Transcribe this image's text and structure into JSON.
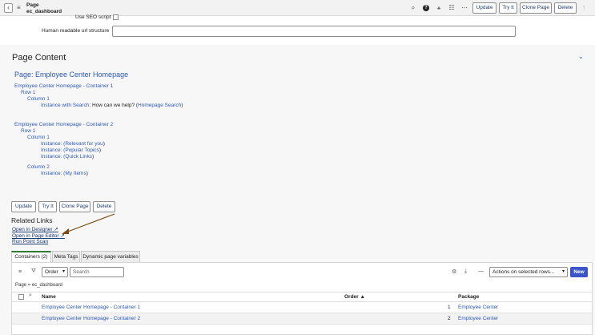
{
  "header": {
    "record_type": "Page",
    "record_name": "ec_dashboard",
    "buttons": [
      "Update",
      "Try It",
      "Clone Page",
      "Delete"
    ],
    "icons": [
      "attachment-icon",
      "help-icon",
      "activity-icon",
      "settings-sliders-icon",
      "more-icon"
    ]
  },
  "form": {
    "seo_label": "Use SEO script",
    "url_label": "Human readable url structure",
    "url_value": ""
  },
  "page_content": {
    "title": "Page Content",
    "page_link_label": "Page: Employee Center Homepage",
    "container1": {
      "name": "Employee Center Homepage - Container 1",
      "row": "Row 1",
      "column": "Column 1",
      "instance_link": "Instance with Search",
      "instance_text": ": How can we help?  (",
      "instance_paren_link": "Homepage Search",
      "instance_close": ")"
    },
    "container2": {
      "name": "Employee Center Homepage - Container 2",
      "row": "Row 1",
      "column1": "Column 1",
      "instances_col1": [
        {
          "prefix": "Instance:  (",
          "link": "Relevant for you",
          "suffix": ")"
        },
        {
          "prefix": "Instance:  (",
          "link": "Popular Topics",
          "suffix": ")"
        },
        {
          "prefix": "Instance:  (",
          "link": "Quick Links",
          "suffix": ")"
        }
      ],
      "column2": "Column 2",
      "instances_col2": [
        {
          "prefix": "Instance:  (",
          "link": "My Items",
          "suffix": ")"
        }
      ]
    }
  },
  "bottom_buttons": [
    "Update",
    "Try It",
    "Clone Page",
    "Delete"
  ],
  "related_links": {
    "title": "Related Links",
    "items": [
      "Open in Designer",
      "Open in Page Editor",
      "Run Point Scan"
    ]
  },
  "tabs": [
    "Containers (2)",
    "Meta Tags",
    "Dynamic page variables"
  ],
  "related_list": {
    "search_field": "Order",
    "search_placeholder": "Search",
    "actions_label": "Actions on selected rows...",
    "new_label": "New",
    "filter_text": "Page = ec_dashboard",
    "columns": [
      "Name",
      "Order",
      "Package"
    ],
    "sort_indicator": "▲",
    "rows": [
      {
        "name": "Employee Center Homepage - Container 1",
        "order": "1",
        "package": "Employee Center"
      },
      {
        "name": "Employee Center Homepage - Container 2",
        "order": "2",
        "package": "Employee Center"
      }
    ]
  },
  "colors": {
    "link": "#2c5ab8",
    "primary_button": "#3b55c9",
    "active_tab": "#2e7d32",
    "annotation_arrow": "#7a4a12"
  }
}
